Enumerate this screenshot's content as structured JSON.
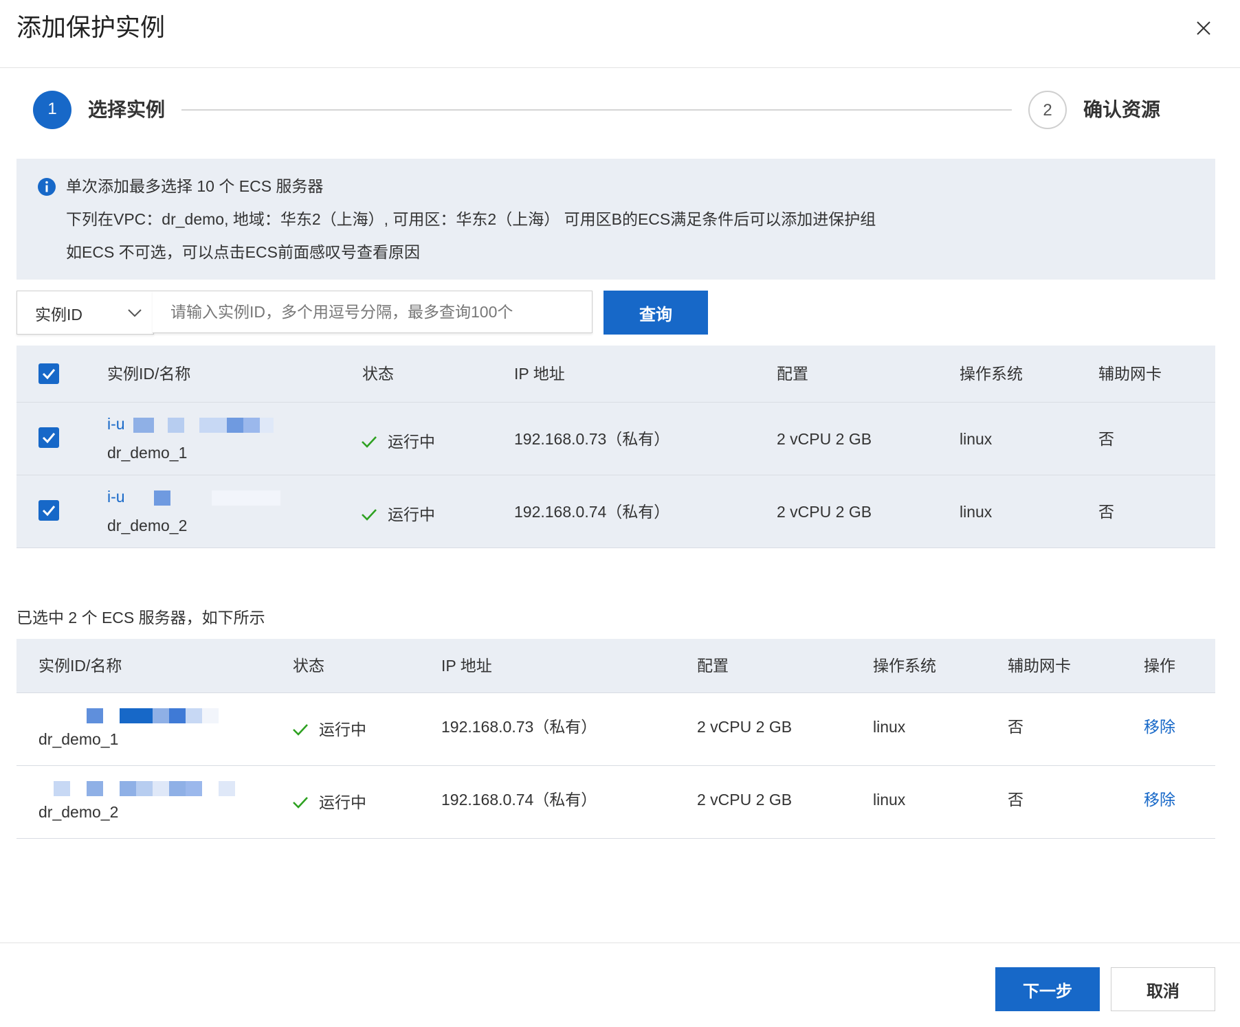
{
  "dialog": {
    "title": "添加保护实例",
    "close_icon": "close-icon"
  },
  "steps": [
    {
      "number": "1",
      "label": "选择实例",
      "active": true
    },
    {
      "number": "2",
      "label": "确认资源",
      "active": false
    }
  ],
  "notice": {
    "icon": "info-icon",
    "lines": [
      "单次添加最多选择 10 个 ECS 服务器",
      "下列在VPC：dr_demo, 地域：华东2（上海）, 可用区：华东2（上海） 可用区B的ECS满足条件后可以添加进保护组",
      "如ECS 不可选，可以点击ECS前面感叹号查看原因"
    ]
  },
  "search": {
    "select_value": "实例ID",
    "placeholder": "请输入实例ID，多个用逗号分隔，最多查询100个",
    "query_label": "查询"
  },
  "instance_table": {
    "columns": [
      "实例ID/名称",
      "状态",
      "IP 地址",
      "配置",
      "操作系统",
      "辅助网卡"
    ],
    "rows": [
      {
        "id_prefix": "i-u",
        "name": "dr_demo_1",
        "status": "运行中",
        "ip": "192.168.0.73（私有）",
        "config": "2 vCPU 2 GB",
        "os": "linux",
        "secondary_nic": "否",
        "checked": true
      },
      {
        "id_prefix": "i-u",
        "name": "dr_demo_2",
        "status": "运行中",
        "ip": "192.168.0.74（私有）",
        "config": "2 vCPU 2 GB",
        "os": "linux",
        "secondary_nic": "否",
        "checked": true
      }
    ]
  },
  "selected": {
    "caption": "已选中 2 个 ECS 服务器，如下所示",
    "columns": [
      "实例ID/名称",
      "状态",
      "IP 地址",
      "配置",
      "操作系统",
      "辅助网卡",
      "操作"
    ],
    "rows": [
      {
        "name": "dr_demo_1",
        "status": "运行中",
        "ip": "192.168.0.73（私有）",
        "config": "2 vCPU 2 GB",
        "os": "linux",
        "secondary_nic": "否",
        "action": "移除"
      },
      {
        "name": "dr_demo_2",
        "status": "运行中",
        "ip": "192.168.0.74（私有）",
        "config": "2 vCPU 2 GB",
        "os": "linux",
        "secondary_nic": "否",
        "action": "移除"
      }
    ]
  },
  "footer": {
    "next_label": "下一步",
    "cancel_label": "取消"
  },
  "colors": {
    "primary": "#1768c8",
    "notice_bg": "#eaeef4",
    "success": "#2ea121"
  }
}
